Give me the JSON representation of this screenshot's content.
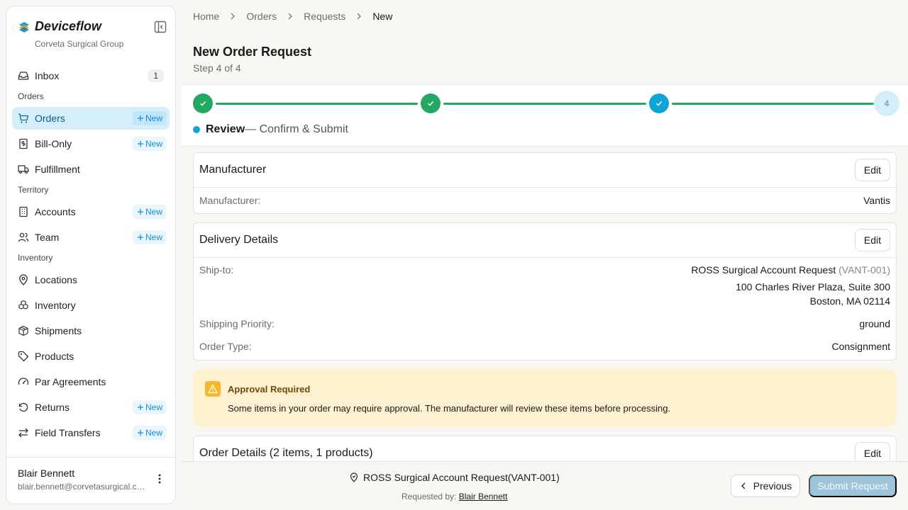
{
  "app": {
    "name": "Deviceflow",
    "org": "Corveta Surgical Group"
  },
  "sidebar": {
    "inbox": {
      "label": "Inbox",
      "badge": "1"
    },
    "sections": {
      "orders": "Orders",
      "territory": "Territory",
      "inventory": "Inventory"
    },
    "items": {
      "orders": "Orders",
      "bill_only": "Bill-Only",
      "fulfillment": "Fulfillment",
      "accounts": "Accounts",
      "team": "Team",
      "locations": "Locations",
      "inventory": "Inventory",
      "shipments": "Shipments",
      "products": "Products",
      "par_agreements": "Par Agreements",
      "returns": "Returns",
      "field_transfers": "Field Transfers"
    },
    "new_label": "New",
    "user": {
      "name": "Blair Bennett",
      "email": "blair.bennett@corvetasurgical.com"
    }
  },
  "breadcrumb": [
    "Home",
    "Orders",
    "Requests",
    "New"
  ],
  "page": {
    "title": "New Order Request",
    "step": "Step 4 of 4"
  },
  "stepper": {
    "todo_number": "4",
    "caption_bold": "Review",
    "caption_rest": "— Confirm & Submit"
  },
  "manufacturer_card": {
    "title": "Manufacturer",
    "edit": "Edit",
    "label": "Manufacturer:",
    "value": "Vantis"
  },
  "delivery_card": {
    "title": "Delivery Details",
    "edit": "Edit",
    "ship_to_label": "Ship-to:",
    "ship_to_name": "ROSS Surgical Account Request",
    "ship_to_code": "(VANT-001)",
    "address_line1": "100 Charles River Plaza, Suite 300",
    "address_line2": "Boston, MA 02114",
    "priority_label": "Shipping Priority:",
    "priority_value": "ground",
    "order_type_label": "Order Type:",
    "order_type_value": "Consignment"
  },
  "alert": {
    "title": "Approval Required",
    "text": "Some items in your order may require approval. The manufacturer will review these items before processing."
  },
  "order_details_card": {
    "title": "Order Details (2 items, 1 products)",
    "edit": "Edit"
  },
  "footer": {
    "account": "ROSS Surgical Account Request(VANT-001)",
    "requested_by_label": "Requested by:",
    "requested_by_name": "Blair Bennett",
    "previous": "Previous",
    "submit": "Submit Request"
  },
  "colors": {
    "accent": "#0ea5d6",
    "success": "#22a861",
    "warning_bg": "#fdf1cf",
    "active_nav": "#d4eefa"
  }
}
